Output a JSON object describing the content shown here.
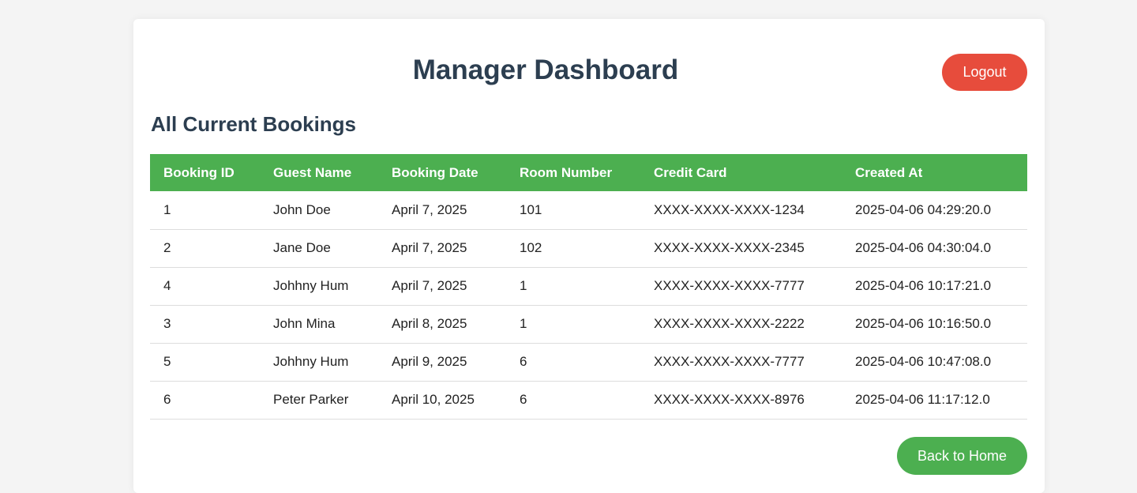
{
  "header": {
    "title": "Manager Dashboard",
    "logout_label": "Logout"
  },
  "bookings": {
    "section_title": "All Current Bookings",
    "columns": [
      "Booking ID",
      "Guest Name",
      "Booking Date",
      "Room Number",
      "Credit Card",
      "Created At"
    ],
    "rows": [
      [
        "1",
        "John Doe",
        "April 7, 2025",
        "101",
        "XXXX-XXXX-XXXX-1234",
        "2025-04-06 04:29:20.0"
      ],
      [
        "2",
        "Jane Doe",
        "April 7, 2025",
        "102",
        "XXXX-XXXX-XXXX-2345",
        "2025-04-06 04:30:04.0"
      ],
      [
        "4",
        "Johhny Hum",
        "April 7, 2025",
        "1",
        "XXXX-XXXX-XXXX-7777",
        "2025-04-06 10:17:21.0"
      ],
      [
        "3",
        "John Mina",
        "April 8, 2025",
        "1",
        "XXXX-XXXX-XXXX-2222",
        "2025-04-06 10:16:50.0"
      ],
      [
        "5",
        "Johhny Hum",
        "April 9, 2025",
        "6",
        "XXXX-XXXX-XXXX-7777",
        "2025-04-06 10:47:08.0"
      ],
      [
        "6",
        "Peter Parker",
        "April 10, 2025",
        "6",
        "XXXX-XXXX-XXXX-8976",
        "2025-04-06 11:17:12.0"
      ]
    ]
  },
  "footer": {
    "back_label": "Back to Home"
  },
  "colors": {
    "header_green": "#4caf50",
    "logout_red": "#e74c3c",
    "title_navy": "#2c3e50"
  }
}
